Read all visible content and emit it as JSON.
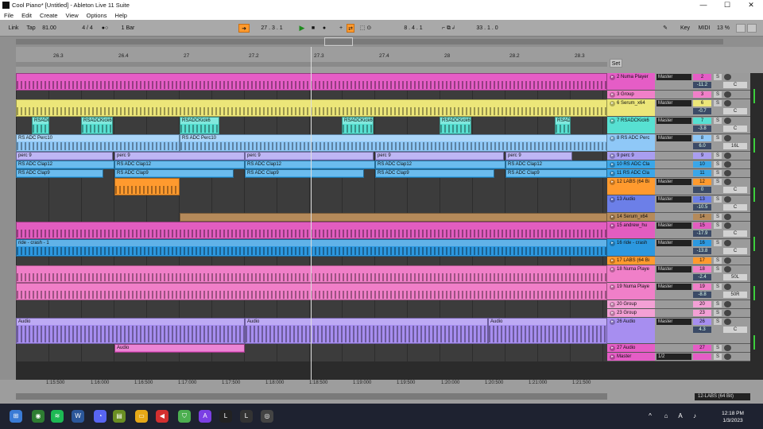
{
  "window": {
    "title": "Cool Piano* [Untitled] - Ableton Live 11 Suite",
    "min": "—",
    "max": "☐",
    "close": "✕"
  },
  "menu": [
    "File",
    "Edit",
    "Create",
    "View",
    "Options",
    "Help"
  ],
  "control": {
    "link": "Link",
    "tap": "Tap",
    "tempo": "81.00",
    "sig": "4 / 4",
    "metro": "1 Bar",
    "pos": "27 .  3 .  1",
    "loop_start": "8 .  4 .  1",
    "loop_len": "33 .  1 .  0",
    "key": "Key",
    "midi": "MIDI",
    "cpu": "13 %",
    "follow_icon": "follow-arrow-icon"
  },
  "ruler": {
    "ticks": [
      "26.3",
      "26.4",
      "27",
      "27.2",
      "27.3",
      "27.4",
      "28",
      "28.2",
      "28.3"
    ],
    "set": "Set"
  },
  "tracks": [
    {
      "num": "2",
      "name": "2 Numa Player",
      "color": "#e55dc6",
      "route": "Master",
      "vol": "-11.2",
      "vol2": "-0.5",
      "pan": "C",
      "pan2": "C",
      "h": 22
    },
    {
      "num": "3",
      "name": "3 Group",
      "color": "#f07fc8",
      "route": "",
      "vol": "",
      "pan": "",
      "h": 11
    },
    {
      "num": "6",
      "name": "6 Serum_x64",
      "color": "#ece679",
      "route": "Master",
      "vol": "-0.7",
      "pan": "C",
      "h": 22
    },
    {
      "num": "7",
      "name": "7 RSADCKick6",
      "color": "#57e0d2",
      "route": "Master",
      "vol": "-3.8",
      "pan": "C",
      "h": 22
    },
    {
      "num": "8",
      "name": "8 RS ADC Perc",
      "color": "#8fc8f7",
      "route": "Master",
      "vol": "6.0",
      "pan": "16L",
      "h": 22
    },
    {
      "num": "9",
      "name": "9 perc 9",
      "color": "#a99ef0",
      "route": "",
      "vol": "",
      "pan": "",
      "h": 11
    },
    {
      "num": "10",
      "name": "10 RS ADC Cla",
      "color": "#3aa6e8",
      "route": "",
      "vol": "",
      "pan": "",
      "h": 11
    },
    {
      "num": "11",
      "name": "11 RS ADC Cla",
      "color": "#3aa6e8",
      "route": "",
      "vol": "",
      "pan": "",
      "h": 11
    },
    {
      "num": "12",
      "name": "12 LABS (64 Bi",
      "color": "#ff9a2e",
      "route": "Master",
      "vol": "0",
      "pan": "C",
      "h": 22
    },
    {
      "num": "13",
      "name": "13 Audio",
      "color": "#6c7fe8",
      "route": "Master",
      "vol": "-10.5",
      "pan": "C",
      "h": 22
    },
    {
      "num": "14",
      "name": "14 Serum_x64",
      "color": "#b58a5a",
      "route": "",
      "vol": "",
      "pan": "",
      "h": 11
    },
    {
      "num": "15",
      "name": "15 andrew_hu",
      "color": "#e25dc0",
      "route": "Master",
      "vol": "-17.9",
      "pan": "C",
      "h": 22
    },
    {
      "num": "16",
      "name": "16 ride - crash",
      "color": "#2c98e0",
      "route": "Master",
      "vol": "-13.8",
      "pan": "C",
      "h": 22
    },
    {
      "num": "17",
      "name": "17 LABS (64 Bi",
      "color": "#ff9a2e",
      "route": "",
      "vol": "",
      "pan": "",
      "h": 11
    },
    {
      "num": "18",
      "name": "18 Numa Playe",
      "color": "#f07fc8",
      "route": "Master",
      "vol": "-2.4",
      "pan": "50L",
      "h": 22
    },
    {
      "num": "19",
      "name": "19 Numa Playe",
      "color": "#f07fc8",
      "route": "Master",
      "vol": "-8.8",
      "pan": "50R",
      "h": 22
    },
    {
      "num": "20",
      "name": "20 Group",
      "color": "#f3a0d5",
      "route": "",
      "vol": "",
      "pan": "",
      "h": 11
    },
    {
      "num": "23",
      "name": "23 Group",
      "color": "#f3a0d5",
      "route": "",
      "vol": "",
      "pan": "",
      "h": 11
    },
    {
      "num": "26",
      "name": "26 Audio",
      "color": "#a78ef0",
      "route": "Master",
      "vol": "4.3",
      "pan": "C",
      "h": 33
    },
    {
      "num": "27",
      "name": "27 Audio",
      "color": "#e55dc6",
      "route": "",
      "vol": "",
      "pan": "",
      "h": 11
    },
    {
      "num": "",
      "name": "Master",
      "color": "#e55dc6",
      "route": "1/2",
      "vol": "0",
      "pan": "0",
      "h": 11
    }
  ],
  "clips": {
    "kick": "RSADCKick6",
    "perc10": "RS ADC Perc10",
    "perc9": "perc 9",
    "clap12": "RS ADC Clap12",
    "clap9": "RS ADC Clap9",
    "ride": "ride - crash - 1",
    "audio": "Audio"
  },
  "bottom": {
    "times": [
      "1:15:500",
      "1:16:000",
      "1:16:500",
      "1:17:000",
      "1:17:500",
      "1:18:000",
      "1:18:500",
      "1:19:000",
      "1:19:500",
      "1:20:000",
      "1:20:500",
      "1:21:000",
      "1:21:500"
    ],
    "status": "12-LABS (64 Bit)"
  },
  "taskbar": {
    "time": "12:18 PM",
    "date": "1/3/2023"
  }
}
